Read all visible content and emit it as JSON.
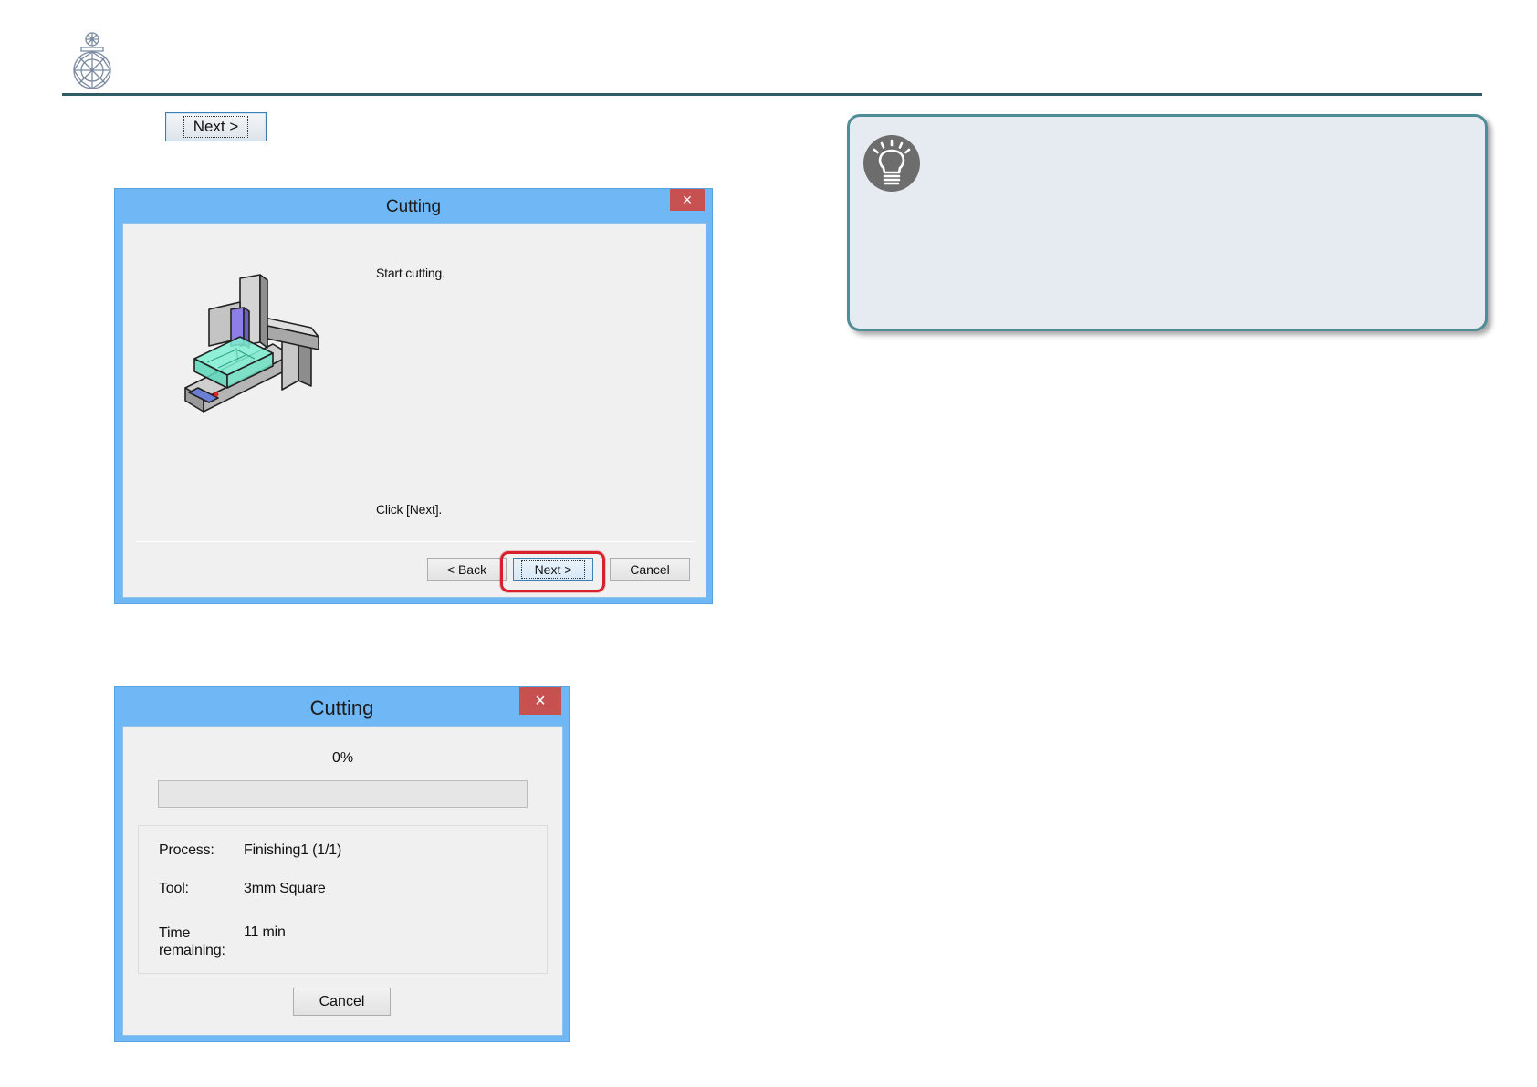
{
  "inline_step": {
    "next_label": "Next >"
  },
  "dialog_confirm": {
    "title": "Cutting",
    "close_glyph": "×",
    "message_top": "Start cutting.",
    "message_bottom": "Click [Next].",
    "buttons": {
      "back": "< Back",
      "next": "Next >",
      "cancel": "Cancel"
    }
  },
  "dialog_progress": {
    "title": "Cutting",
    "close_glyph": "×",
    "percent_text": "0%",
    "progress_value": 0,
    "rows": {
      "process_label": "Process:",
      "process_value": "Finishing1 (1/1)",
      "tool_label": "Tool:",
      "tool_value": "3mm Square",
      "time_label_line1": "Time",
      "time_label_line2": "remaining:",
      "time_value": "11 min"
    },
    "cancel_label": "Cancel"
  },
  "icons": {
    "logo": "gem-logo-icon",
    "hint": "lightbulb-icon",
    "machine": "milling-machine-illustration"
  },
  "colors": {
    "header_rule": "#2f5b68",
    "titlebar": "#6fb7f5",
    "close_button": "#c75050",
    "highlight": "#d7202a",
    "hint_border": "#4e8c96",
    "hint_background": "#e6ebf1"
  }
}
